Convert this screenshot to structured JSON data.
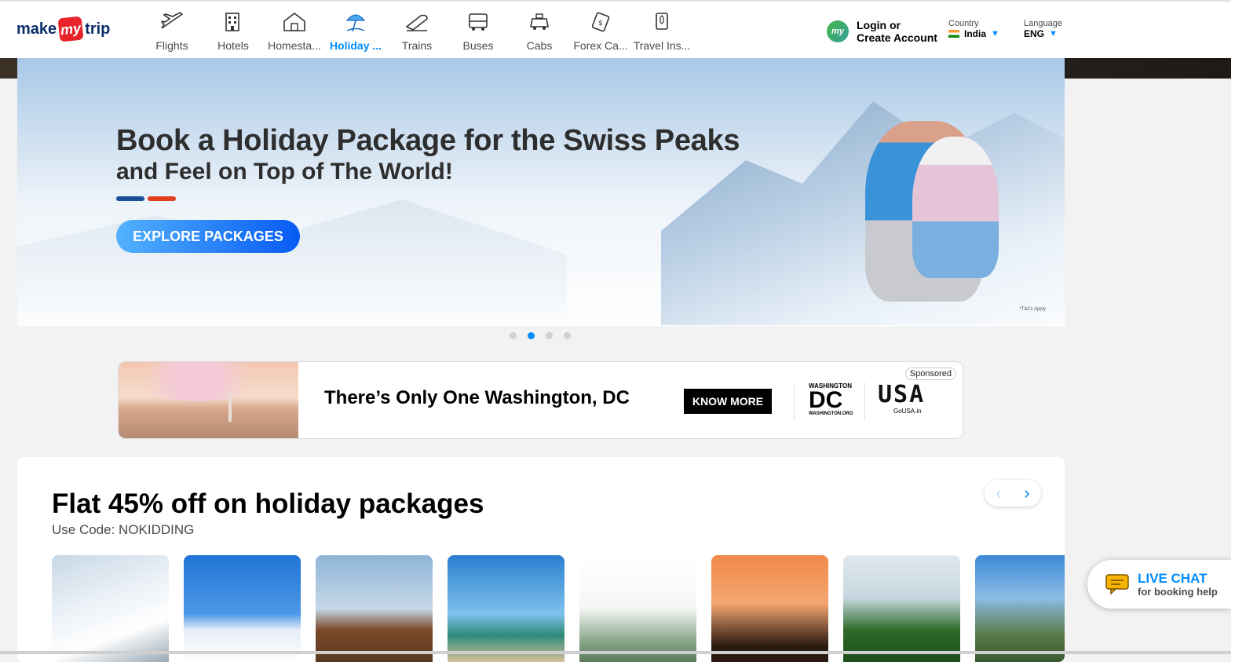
{
  "header": {
    "logo": {
      "make": "make",
      "my": "my",
      "trip": "trip"
    },
    "nav": [
      {
        "label": "Flights",
        "icon": "flight-icon",
        "active": false
      },
      {
        "label": "Hotels",
        "icon": "hotel-icon",
        "active": false
      },
      {
        "label": "Homesta...",
        "icon": "homestay-icon",
        "active": false
      },
      {
        "label": "Holiday ...",
        "icon": "holiday-icon",
        "active": true
      },
      {
        "label": "Trains",
        "icon": "train-icon",
        "active": false
      },
      {
        "label": "Buses",
        "icon": "bus-icon",
        "active": false
      },
      {
        "label": "Cabs",
        "icon": "cab-icon",
        "active": false
      },
      {
        "label": "Forex Ca...",
        "icon": "forex-card-icon",
        "active": false
      },
      {
        "label": "Travel Ins...",
        "icon": "travel-insurance-icon",
        "active": false
      }
    ],
    "login": {
      "avatar": "my",
      "line1": "Login or",
      "line2": "Create Account"
    },
    "country": {
      "caption": "Country",
      "value": "India"
    },
    "language": {
      "caption": "Language",
      "value": "ENG"
    }
  },
  "hero": {
    "title": "Book a Holiday Package for the Swiss Peaks",
    "subtitle": "and Feel on Top of The World!",
    "cta": "EXPLORE PACKAGES",
    "tc": "*T&Cs Apply",
    "slides": 4,
    "active_slide": 2,
    "bar_colors": [
      "#1b4e9b",
      "#e0401c"
    ]
  },
  "ad": {
    "title": "There’s Only One Washington, DC",
    "cta": "KNOW MORE",
    "sponsored": "Sponsored",
    "dc_logo_top": "WASHINGTON",
    "dc_logo_main": "DC",
    "dc_logo_bottom": "WASHINGTON.ORG",
    "usa_logo_main": "USA",
    "usa_logo_bottom": "GoUSA.in"
  },
  "offers": {
    "title": "Flat 45% off on holiday packages",
    "code": "Use Code: NOKIDDING",
    "prev_icon": "chevron-left-icon",
    "next_icon": "chevron-right-icon",
    "thumbs": [
      {
        "name": "snow-mountain"
      },
      {
        "name": "snow-peak-tree"
      },
      {
        "name": "memorial-temple"
      },
      {
        "name": "beach-palm"
      },
      {
        "name": "hill-resort"
      },
      {
        "name": "sunset-palms"
      },
      {
        "name": "green-hills"
      },
      {
        "name": "mountain-valley"
      }
    ]
  },
  "livechat": {
    "title": "LIVE CHAT",
    "subtitle": "for booking help"
  },
  "colors": {
    "accent": "#008cff",
    "brand_red": "#e8232a",
    "text": "#000000"
  }
}
